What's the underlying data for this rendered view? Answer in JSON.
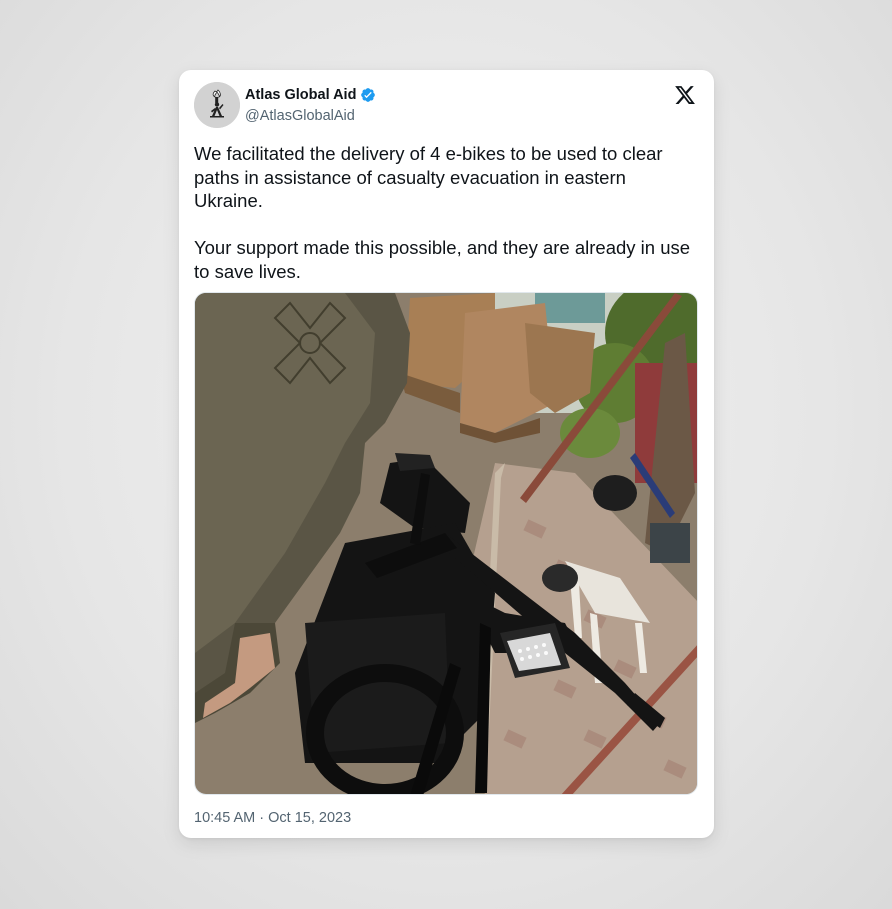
{
  "author": {
    "display_name": "Atlas Global Aid",
    "handle": "@AtlasGlobalAid",
    "verified": true,
    "avatar_icon": "hand-holding-torch-logo-icon"
  },
  "platform": {
    "logo_icon": "x-logo-icon"
  },
  "tweet": {
    "text": "We facilitated the delivery of 4 e-bikes to be used to clear paths in assistance of casualty evacuation in eastern Ukraine.\n\nYour support made this possible, and they are already in use to save lives.",
    "timestamp": "10:45 AM · Oct 15, 2023"
  },
  "media": {
    "kind": "photo",
    "subject": "soldier-standing-beside-black-electric-bike-with-shipping-crates"
  },
  "colors": {
    "verified_blue": "#1d9bf0",
    "text_primary": "#0f1419",
    "text_secondary": "#536471",
    "card_background": "#ffffff"
  }
}
